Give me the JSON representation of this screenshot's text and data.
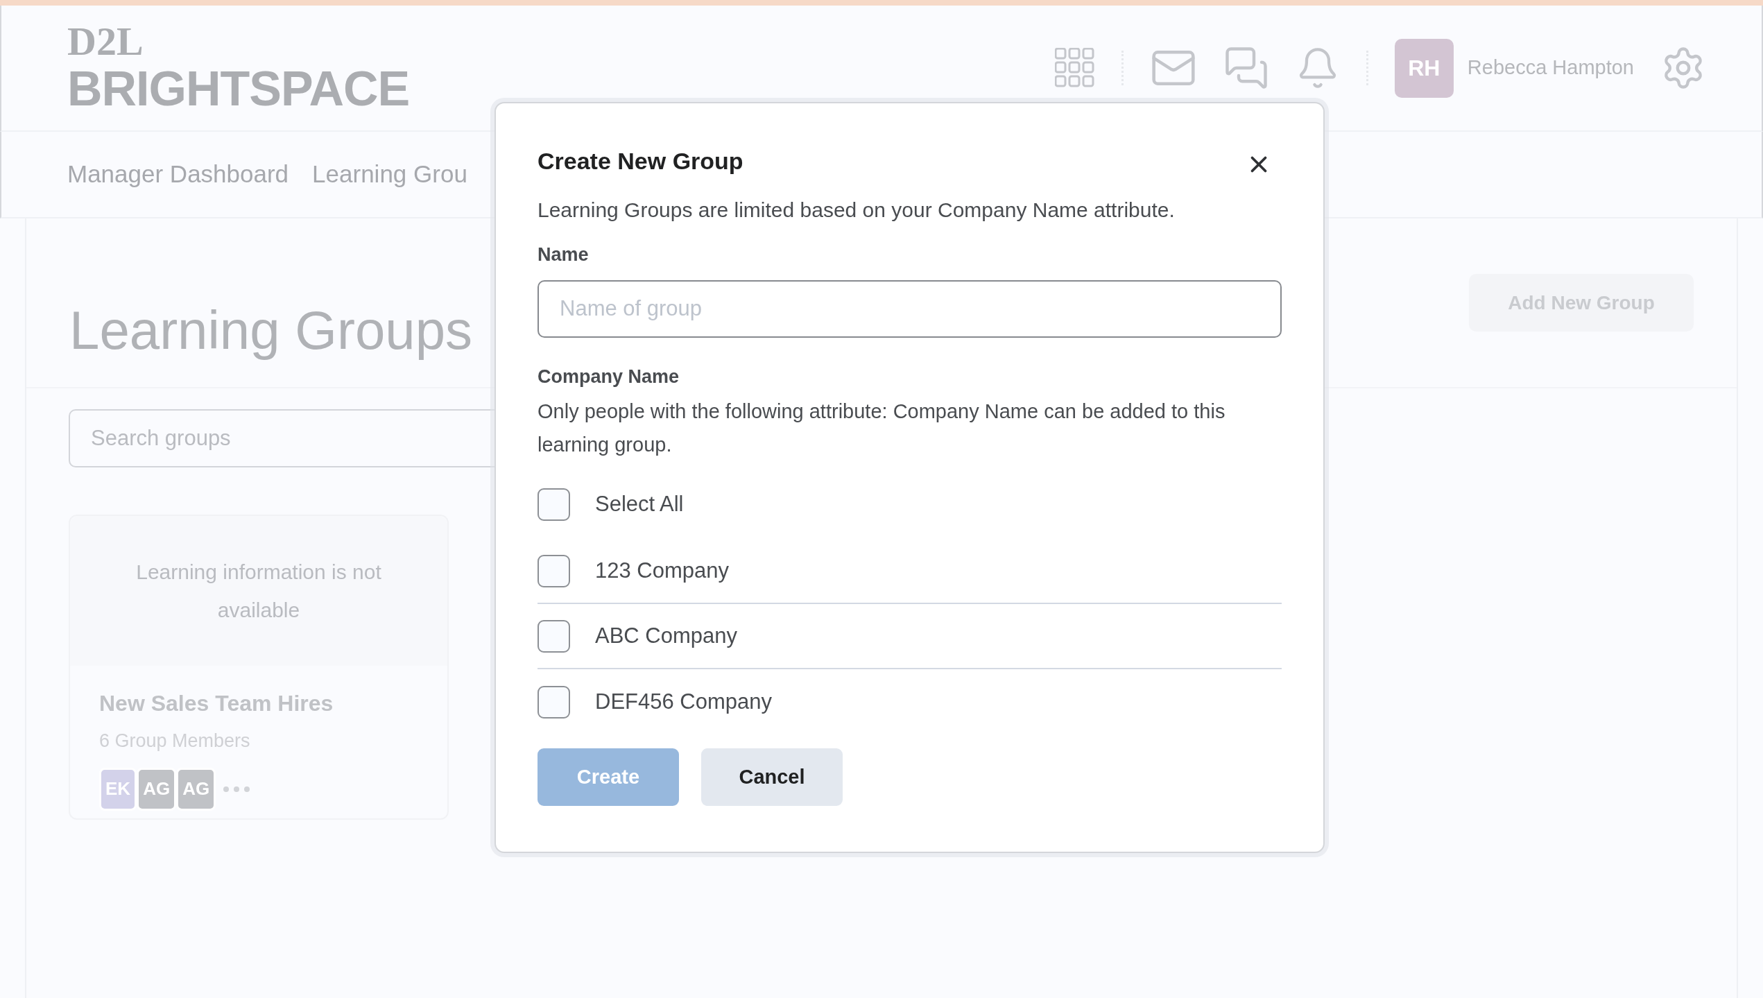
{
  "logo": {
    "top": "D2L",
    "bottom": "BRIGHTSPACE"
  },
  "user": {
    "initials": "RH",
    "name": "Rebecca Hampton"
  },
  "nav": [
    {
      "label": "Manager Dashboard"
    },
    {
      "label": "Learning Grou"
    }
  ],
  "page": {
    "title": "Learning Groups",
    "add_button": "Add New Group",
    "search": {
      "placeholder": "Search groups"
    },
    "cards": [
      {
        "info": "Learning information is not available",
        "title": "New Sales Team Hires",
        "members": "6 Group Members",
        "avatars": [
          {
            "initials": "EK",
            "color": "#d3d2ea"
          },
          {
            "initials": "AG",
            "color": "#c0c2c6"
          },
          {
            "initials": "AG",
            "color": "#c0c2c6"
          }
        ]
      }
    ]
  },
  "dialog": {
    "title": "Create New Group",
    "description": "Learning Groups are limited based on your Company Name attribute.",
    "name_label": "Name",
    "name_placeholder": "Name of group",
    "company_label": "Company Name",
    "company_help": "Only people with the following attribute: Company Name can be added to this learning group.",
    "options": [
      {
        "kind": "select_all",
        "label": "Select All",
        "checked": false
      },
      {
        "kind": "option",
        "label": "123 Company",
        "checked": false
      },
      {
        "kind": "option",
        "label": "ABC Company",
        "checked": false
      },
      {
        "kind": "option",
        "label": "DEF456 Company",
        "checked": false
      }
    ],
    "buttons": [
      {
        "kind": "primary",
        "label": "Create",
        "disabled": true
      },
      {
        "kind": "secondary",
        "label": "Cancel",
        "disabled": false
      }
    ]
  }
}
